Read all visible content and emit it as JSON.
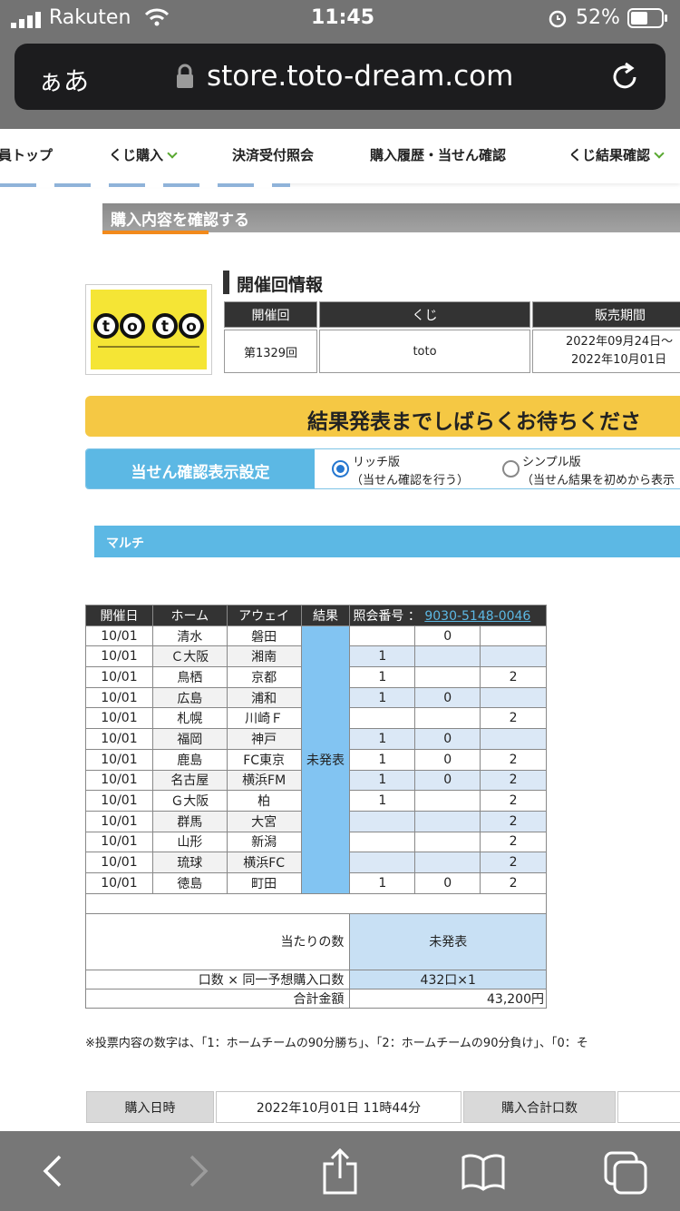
{
  "status": {
    "carrier": "Rakuten",
    "time": "11:45",
    "battery": "52%"
  },
  "browser": {
    "aa": "ぁあ",
    "url": "store.toto-dream.com"
  },
  "nav": [
    "員トップ",
    "くじ購入",
    "決済受付照会",
    "購入履歴・当せん確認",
    "くじ結果確認"
  ],
  "section_title": "購入内容を確認する",
  "round_info": {
    "heading": "開催回情報",
    "headers": [
      "開催回",
      "くじ",
      "販売期間"
    ],
    "round": "第1329回",
    "kuji": "toto",
    "period1": "2022年09月24日〜",
    "period2": "2022年10月01日",
    "logo": "toto"
  },
  "banner": "結果発表までしばらくお待ちくださ",
  "display": {
    "label": "当せん確認表示設定",
    "rich": "リッチ版",
    "rich_sub": "（当せん確認を行う）",
    "simple": "シンプル版",
    "simple_sub": "（当せん結果を初めから表示"
  },
  "multi_label": "マルチ",
  "table": {
    "headers": [
      "開催日",
      "ホーム",
      "アウェイ",
      "結果"
    ],
    "inquiry_label": "照会番号 ：",
    "inquiry_no": "9030-5148-0046",
    "result": "未発表",
    "rows": [
      [
        "10/01",
        "清水",
        "磐田",
        "",
        "0",
        ""
      ],
      [
        "10/01",
        "Ｃ大阪",
        "湘南",
        "1",
        "",
        ""
      ],
      [
        "10/01",
        "鳥栖",
        "京都",
        "1",
        "",
        "2"
      ],
      [
        "10/01",
        "広島",
        "浦和",
        "1",
        "0",
        ""
      ],
      [
        "10/01",
        "札幌",
        "川崎Ｆ",
        "",
        "",
        "2"
      ],
      [
        "10/01",
        "福岡",
        "神戸",
        "1",
        "0",
        ""
      ],
      [
        "10/01",
        "鹿島",
        "FC東京",
        "1",
        "0",
        "2"
      ],
      [
        "10/01",
        "名古屋",
        "横浜FM",
        "1",
        "0",
        "2"
      ],
      [
        "10/01",
        "Ｇ大阪",
        "柏",
        "1",
        "",
        "2"
      ],
      [
        "10/01",
        "群馬",
        "大宮",
        "",
        "",
        "2"
      ],
      [
        "10/01",
        "山形",
        "新潟",
        "",
        "",
        "2"
      ],
      [
        "10/01",
        "琉球",
        "横浜FC",
        "",
        "",
        "2"
      ],
      [
        "10/01",
        "徳島",
        "町田",
        "1",
        "0",
        "2"
      ]
    ],
    "hits_label": "当たりの数",
    "hits_value": "未発表",
    "units_label": "口数 × 同一予想購入口数",
    "units_value": "432口×1",
    "total_label": "合計金額",
    "total_value": "43,200円"
  },
  "note": "※投票内容の数字は、「1：ホームチームの90分勝ち」、「2：ホームチームの90分負け」、「0：そ",
  "purchase": {
    "date_label": "購入日時",
    "date_value": "2022年10月01日 11時44分",
    "count_label": "購入合計口数"
  }
}
